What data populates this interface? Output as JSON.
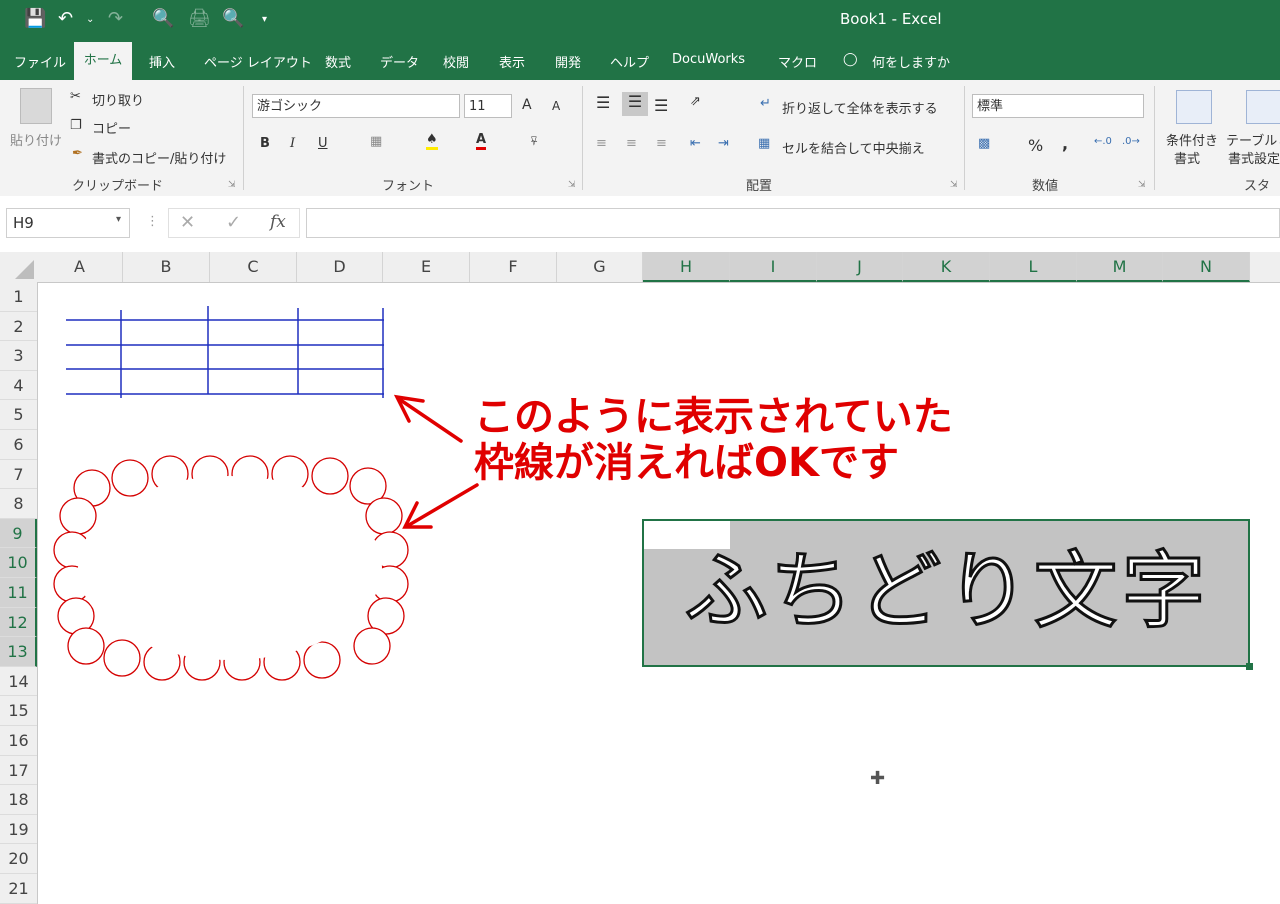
{
  "window": {
    "title": "Book1  -  Excel"
  },
  "tabs": [
    "ファイル",
    "ホーム",
    "挿入",
    "ページ レイアウト",
    "数式",
    "データ",
    "校閲",
    "表示",
    "開発",
    "ヘルプ",
    "DocuWorks",
    "マクロ",
    "何をしますか"
  ],
  "ribbon": {
    "clipboard": {
      "paste": "貼り付け",
      "cut": "切り取り",
      "copy": "コピー",
      "format_painter": "書式のコピー/貼り付け",
      "label": "クリップボード"
    },
    "font": {
      "name": "游ゴシック",
      "size": "11",
      "bold": "B",
      "italic": "I",
      "underline": "U",
      "grow": "A",
      "shrink": "A",
      "color": "A",
      "label": "フォント"
    },
    "alignment": {
      "wrap": "折り返して全体を表示する",
      "merge": "セルを結合して中央揃え",
      "label": "配置"
    },
    "number": {
      "format": "標準",
      "percent": "%",
      "comma": ",",
      "label": "数値"
    },
    "styles": {
      "conditional": "条件付き",
      "conditional2": "書式",
      "table": "テーブルと",
      "table2": "書式設定",
      "label": "スタイル"
    }
  },
  "formula_bar": {
    "name_box": "H9",
    "fx": "fx",
    "value": ""
  },
  "columns": [
    "A",
    "B",
    "C",
    "D",
    "E",
    "F",
    "G",
    "H",
    "I",
    "J",
    "K",
    "L",
    "M",
    "N"
  ],
  "rows": [
    "1",
    "2",
    "3",
    "4",
    "5",
    "6",
    "7",
    "8",
    "9",
    "10",
    "11",
    "12",
    "13",
    "14",
    "15",
    "16",
    "17",
    "18",
    "19",
    "20",
    "21"
  ],
  "selected_col": "H",
  "annotation": {
    "line1": "このように表示されていた",
    "line2": "枠線が消えればOKです"
  },
  "wordart": {
    "text": "ふちどり文字"
  },
  "colors": {
    "accent": "#217346",
    "annotation": "#e00000",
    "table_lines": "#1f2fbf"
  }
}
